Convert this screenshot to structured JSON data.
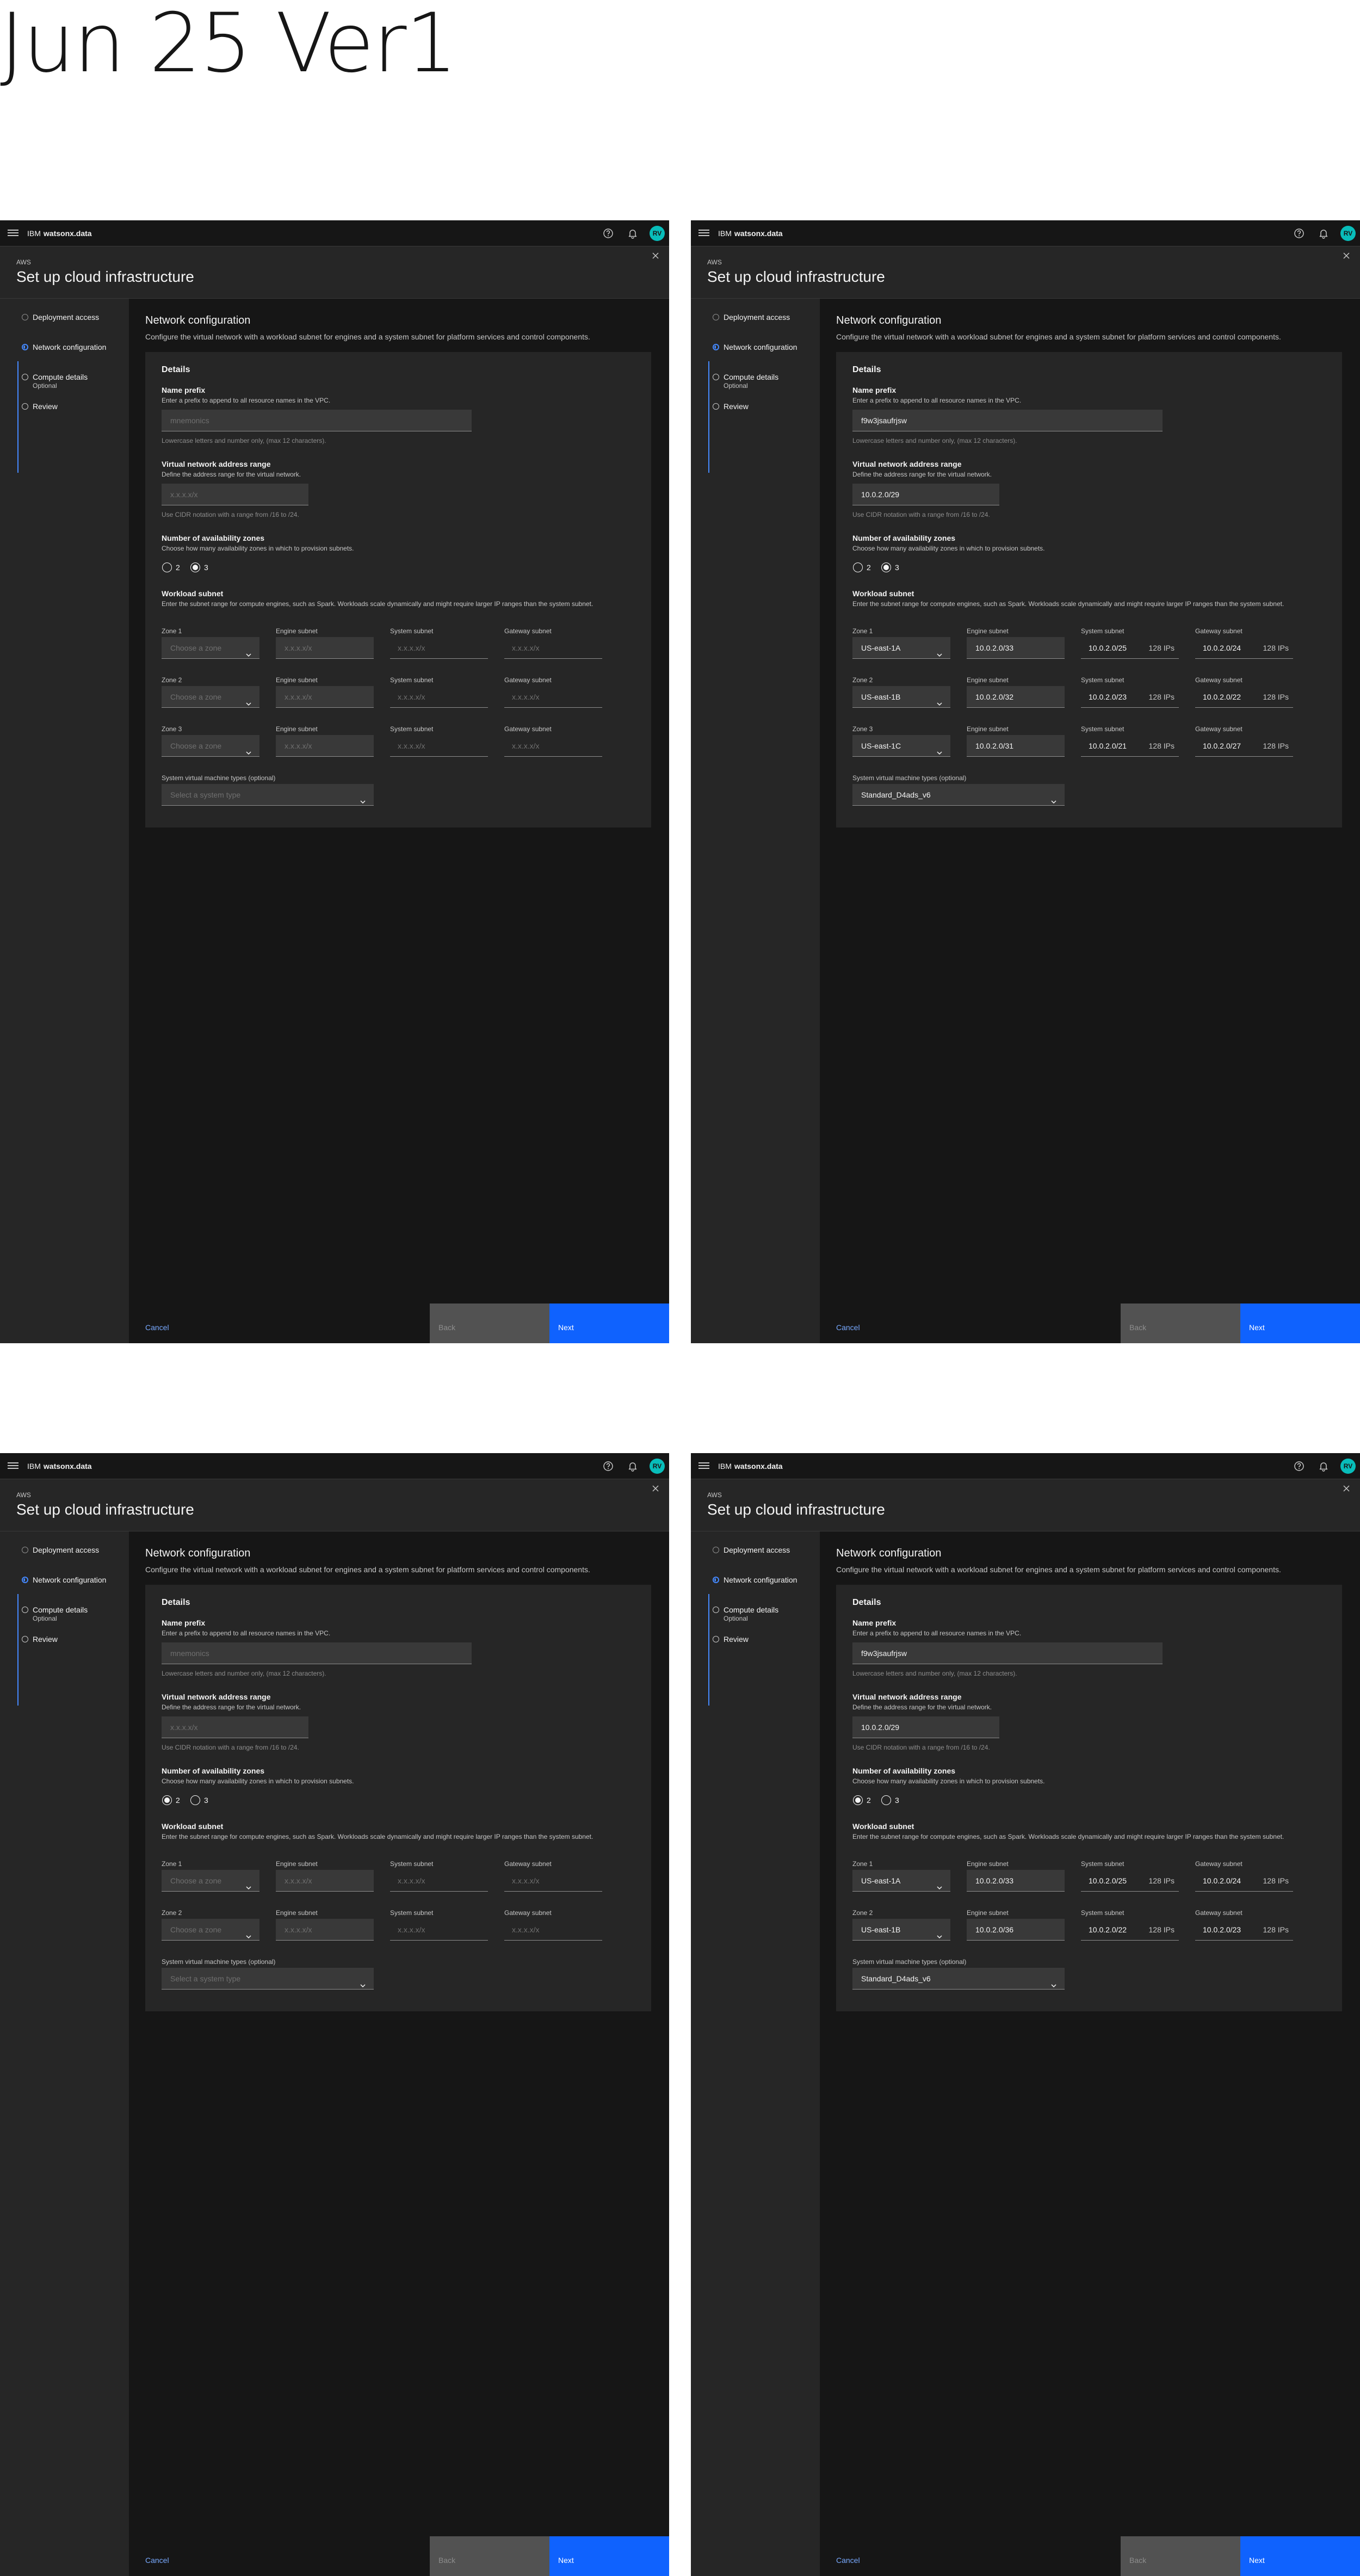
{
  "page_title": "Jun 25 Ver1",
  "common": {
    "brand_ibm": "IBM",
    "brand_product": "watsonx.data",
    "avatar": "RV",
    "modal_label": "AWS",
    "modal_title": "Set up cloud infrastructure",
    "steps": [
      {
        "label": "Deployment access",
        "sub": ""
      },
      {
        "label": "Network configuration",
        "sub": ""
      },
      {
        "label": "Compute details",
        "sub": "Optional"
      },
      {
        "label": "Review",
        "sub": ""
      }
    ],
    "section_title": "Network configuration",
    "section_desc": "Configure the virtual network with a workload subnet for engines and a system subnet for platform services and control components.",
    "tile_title": "Details",
    "name_prefix_label": "Name prefix",
    "name_prefix_help": "Enter a prefix to append to all resource names in the VPC.",
    "name_prefix_hint": "Lowercase letters and number only, (max 12 characters).",
    "name_prefix_placeholder": "mnemonics",
    "vnet_label": "Virtual network address range",
    "vnet_help": "Define the address range for the virtual network.",
    "vnet_hint": "Use CIDR notation with a range from /16 to /24.",
    "vnet_placeholder": "x.x.x.x/x",
    "az_label": "Number of availability zones",
    "az_help": "Choose how many availability zones in which to provision subnets.",
    "az_options": [
      "2",
      "3"
    ],
    "workload_label": "Workload subnet",
    "workload_help": "Enter the subnet range for compute engines, such as Spark. Workloads scale dynamically and might require larger IP ranges than the system subnet.",
    "col_engine": "Engine subnet",
    "col_system": "System subnet",
    "col_gateway": "Gateway subnet",
    "zone_placeholder": "Choose a zone",
    "cidr_placeholder": "x.x.x.x/x",
    "vm_label": "System virtual machine types (optional)",
    "vm_placeholder": "Select a system type",
    "cancel": "Cancel",
    "back": "Back",
    "next": "Next"
  },
  "variants": [
    {
      "prefix_value": "",
      "vnet_value": "",
      "az_selected": "3",
      "zones": [
        {
          "label": "Zone 1",
          "zone": "",
          "engine": "",
          "system": "",
          "system_ips": "",
          "gateway": "",
          "gateway_ips": ""
        },
        {
          "label": "Zone 2",
          "zone": "",
          "engine": "",
          "system": "",
          "system_ips": "",
          "gateway": "",
          "gateway_ips": ""
        },
        {
          "label": "Zone 3",
          "zone": "",
          "engine": "",
          "system": "",
          "system_ips": "",
          "gateway": "",
          "gateway_ips": ""
        }
      ],
      "vm_value": ""
    },
    {
      "prefix_value": "f9w3jsaufrjsw",
      "vnet_value": "10.0.2.0/29",
      "az_selected": "3",
      "zones": [
        {
          "label": "Zone 1",
          "zone": "US-east-1A",
          "engine": "10.0.2.0/33",
          "system": "10.0.2.0/25",
          "system_ips": "128 IPs",
          "gateway": "10.0.2.0/24",
          "gateway_ips": "128 IPs"
        },
        {
          "label": "Zone 2",
          "zone": "US-east-1B",
          "engine": "10.0.2.0/32",
          "system": "10.0.2.0/23",
          "system_ips": "128 IPs",
          "gateway": "10.0.2.0/22",
          "gateway_ips": "128 IPs"
        },
        {
          "label": "Zone 3",
          "zone": "US-east-1C",
          "engine": "10.0.2.0/31",
          "system": "10.0.2.0/21",
          "system_ips": "128 IPs",
          "gateway": "10.0.2.0/27",
          "gateway_ips": "128 IPs"
        }
      ],
      "vm_value": "Standard_D4ads_v6"
    },
    {
      "prefix_value": "",
      "vnet_value": "",
      "az_selected": "2",
      "zones": [
        {
          "label": "Zone 1",
          "zone": "",
          "engine": "",
          "system": "",
          "system_ips": "",
          "gateway": "",
          "gateway_ips": ""
        },
        {
          "label": "Zone 2",
          "zone": "",
          "engine": "",
          "system": "",
          "system_ips": "",
          "gateway": "",
          "gateway_ips": ""
        }
      ],
      "vm_value": ""
    },
    {
      "prefix_value": "f9w3jsaufrjsw",
      "vnet_value": "10.0.2.0/29",
      "az_selected": "2",
      "zones": [
        {
          "label": "Zone 1",
          "zone": "US-east-1A",
          "engine": "10.0.2.0/33",
          "system": "10.0.2.0/25",
          "system_ips": "128 IPs",
          "gateway": "10.0.2.0/24",
          "gateway_ips": "128 IPs"
        },
        {
          "label": "Zone 2",
          "zone": "US-east-1B",
          "engine": "10.0.2.0/36",
          "system": "10.0.2.0/22",
          "system_ips": "128 IPs",
          "gateway": "10.0.2.0/23",
          "gateway_ips": "128 IPs"
        }
      ],
      "vm_value": "Standard_D4ads_v6"
    }
  ]
}
